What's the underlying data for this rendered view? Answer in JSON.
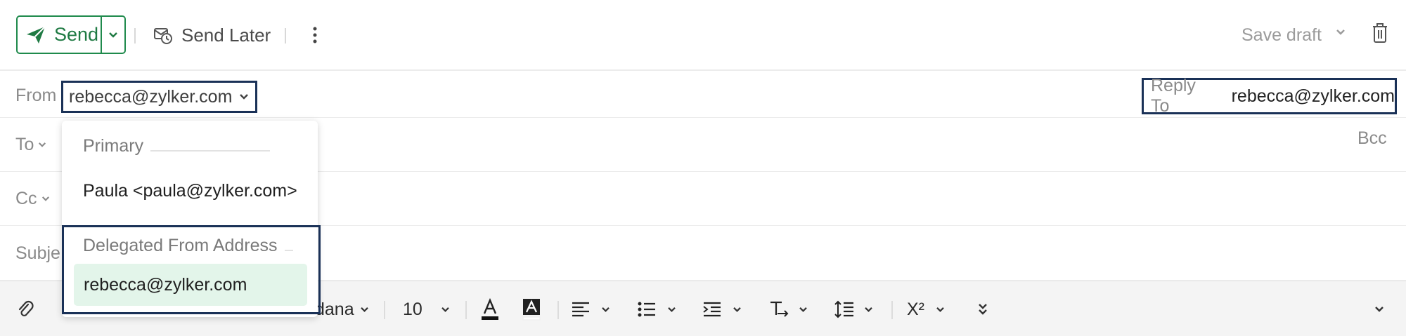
{
  "toolbar": {
    "send_label": "Send",
    "send_later_label": "Send Later",
    "save_draft_label": "Save draft"
  },
  "fields": {
    "from_label": "From",
    "from_value": "rebecca@zylker.com",
    "reply_to_label": "Reply To",
    "reply_to_value": "rebecca@zylker.com",
    "to_label": "To",
    "bcc_label": "Bcc",
    "cc_label": "Cc",
    "subject_label_visible": "Subje"
  },
  "format_bar": {
    "font_name_visible": "dana",
    "font_size": "10",
    "superscript_label": "X²"
  },
  "from_dropdown": {
    "primary_header": "Primary",
    "primary_item": "Paula <paula@zylker.com>",
    "delegated_header": "Delegated From Address",
    "delegated_item": "rebecca@zylker.com"
  },
  "colors": {
    "send_green": "#1f7a43",
    "highlight_border": "#1a3157",
    "selected_bg": "#e3f5ea"
  }
}
